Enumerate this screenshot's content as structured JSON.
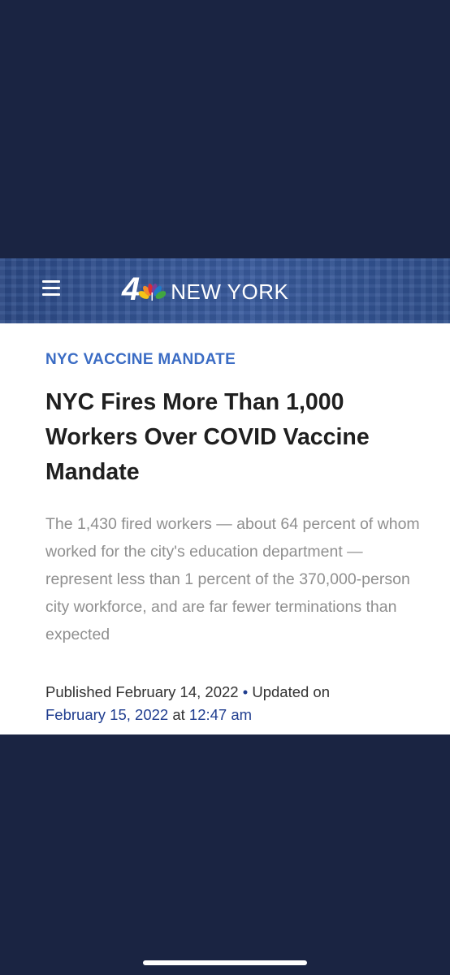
{
  "header": {
    "menu_icon": "hamburger-menu-icon",
    "logo_number": "4",
    "logo_icon": "peacock-icon",
    "logo_text": "NEW YORK",
    "colors": {
      "header_blue": "#345596",
      "page_background": "#1a2442"
    }
  },
  "article": {
    "kicker": "NYC VACCINE MANDATE",
    "headline": "NYC Fires More Than 1,000 Workers Over COVID Vaccine Mandate",
    "dek": "The 1,430 fired workers — about 64 percent of whom worked for the city's education department — represent less than 1 percent of the 370,000-person city workforce, and are far fewer terminations than expected",
    "published_label": "Published February 14, 2022",
    "separator": "•",
    "updated_label": "Updated on",
    "updated_date": "February 15, 2022",
    "updated_at": "at",
    "updated_time": "12:47 am",
    "colors": {
      "kicker": "#3b6cc4",
      "date_link": "#1f3d8f"
    }
  }
}
